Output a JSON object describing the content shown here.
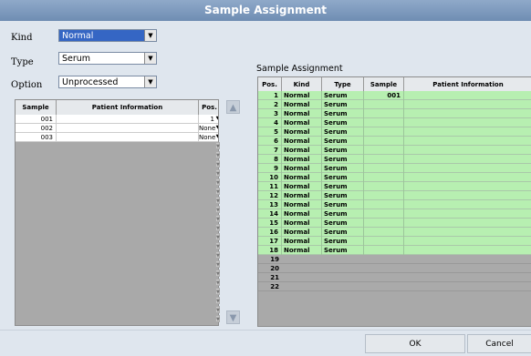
{
  "window": {
    "title": "Sample Assignment"
  },
  "form": {
    "kind_label": "Kind",
    "kind_value": "Normal",
    "type_label": "Type",
    "type_value": "Serum",
    "option_label": "Option",
    "option_value": "Unprocessed"
  },
  "left_table": {
    "headers": [
      "Sample No.",
      "Patient Information",
      "Pos."
    ],
    "rows": [
      {
        "sample_no": "001",
        "patient_info": "",
        "pos": "1"
      },
      {
        "sample_no": "002",
        "patient_info": "",
        "pos": "None"
      },
      {
        "sample_no": "003",
        "patient_info": "",
        "pos": "None"
      }
    ]
  },
  "assignment": {
    "title": "Sample Assignment",
    "headers": [
      "Pos.",
      "Kind",
      "Type",
      "Sample No.",
      "Patient Information"
    ],
    "rows": [
      {
        "pos": "1",
        "kind": "Normal",
        "type": "Serum",
        "sample_no": "001"
      },
      {
        "pos": "2",
        "kind": "Normal",
        "type": "Serum",
        "sample_no": ""
      },
      {
        "pos": "3",
        "kind": "Normal",
        "type": "Serum",
        "sample_no": ""
      },
      {
        "pos": "4",
        "kind": "Normal",
        "type": "Serum",
        "sample_no": ""
      },
      {
        "pos": "5",
        "kind": "Normal",
        "type": "Serum",
        "sample_no": ""
      },
      {
        "pos": "6",
        "kind": "Normal",
        "type": "Serum",
        "sample_no": ""
      },
      {
        "pos": "7",
        "kind": "Normal",
        "type": "Serum",
        "sample_no": ""
      },
      {
        "pos": "8",
        "kind": "Normal",
        "type": "Serum",
        "sample_no": ""
      },
      {
        "pos": "9",
        "kind": "Normal",
        "type": "Serum",
        "sample_no": ""
      },
      {
        "pos": "10",
        "kind": "Normal",
        "type": "Serum",
        "sample_no": ""
      },
      {
        "pos": "11",
        "kind": "Normal",
        "type": "Serum",
        "sample_no": ""
      },
      {
        "pos": "12",
        "kind": "Normal",
        "type": "Serum",
        "sample_no": ""
      },
      {
        "pos": "13",
        "kind": "Normal",
        "type": "Serum",
        "sample_no": ""
      },
      {
        "pos": "14",
        "kind": "Normal",
        "type": "Serum",
        "sample_no": ""
      },
      {
        "pos": "15",
        "kind": "Normal",
        "type": "Serum",
        "sample_no": ""
      },
      {
        "pos": "16",
        "kind": "Normal",
        "type": "Serum",
        "sample_no": ""
      },
      {
        "pos": "17",
        "kind": "Normal",
        "type": "Serum",
        "sample_no": ""
      },
      {
        "pos": "18",
        "kind": "Normal",
        "type": "Serum",
        "sample_no": ""
      },
      {
        "pos": "19",
        "kind": "",
        "type": "",
        "sample_no": ""
      },
      {
        "pos": "20",
        "kind": "",
        "type": "",
        "sample_no": ""
      },
      {
        "pos": "21",
        "kind": "",
        "type": "",
        "sample_no": ""
      },
      {
        "pos": "22",
        "kind": "",
        "type": "",
        "sample_no": ""
      }
    ]
  },
  "buttons": {
    "ok": "OK",
    "cancel": "Cancel"
  },
  "icons": {
    "dropdown": "chevron-down-icon",
    "move_up": "arrow-up-icon",
    "move_down": "arrow-down-icon"
  },
  "colors": {
    "assigned_row": "#b7efb1",
    "titlebar": "#7b97bb",
    "selected": "#3566c4"
  }
}
